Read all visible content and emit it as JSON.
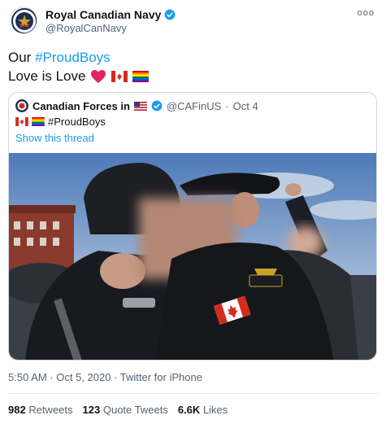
{
  "author": {
    "name": "Royal Canadian Navy",
    "handle": "@RoyalCanNavy",
    "verified_icon": "verified-badge-icon",
    "avatar_icon": "rcn-crest-icon"
  },
  "tweet": {
    "text_prefix": "Our ",
    "hashtag": "#ProudBoys",
    "line2_text": "Love is Love"
  },
  "quoted": {
    "name": "Canadian Forces in",
    "handle": "@CAFinUS",
    "separator": "·",
    "date": "Oct 4",
    "hashtag": "#ProudBoys",
    "show_thread": "Show this thread"
  },
  "meta": {
    "timestamp": "5:50 AM · Oct 5, 2020 · Twitter for iPhone"
  },
  "stats": {
    "retweets_count": "982",
    "retweets_label": "Retweets",
    "quotes_count": "123",
    "quotes_label": "Quote Tweets",
    "likes_count": "6.6K",
    "likes_label": "Likes"
  },
  "colors": {
    "link_blue": "#1d9bf0",
    "text": "#0f1419",
    "muted": "#536471",
    "heart_red": "#e0245e",
    "canada_red": "#d52b1e"
  }
}
